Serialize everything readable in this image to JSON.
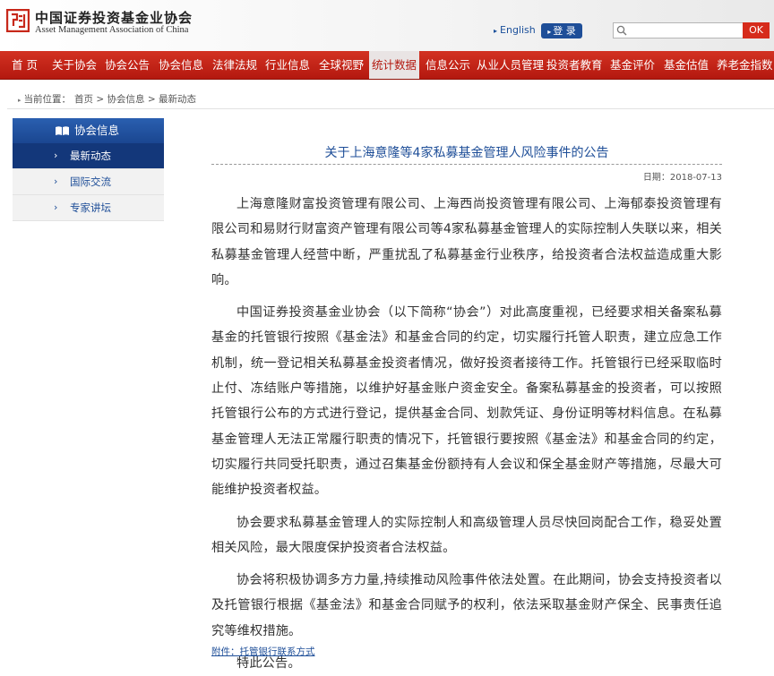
{
  "header": {
    "org_name_cn": "中国证券投资基金业协会",
    "org_name_en": "Asset Management Association of China",
    "lang_link": "English",
    "login_label": "登 录",
    "search_placeholder": "",
    "search_button": "OK"
  },
  "nav": {
    "items": [
      "首 页",
      "关于协会",
      "协会公告",
      "协会信息",
      "法律法规",
      "行业信息",
      "全球视野",
      "统计数据",
      "信息公示",
      "从业人员管理",
      "投资者教育",
      "基金评价",
      "基金估值",
      "养老金指数"
    ],
    "active_index": 7
  },
  "breadcrumb": {
    "prefix": "当前位置：",
    "path": "首页 > 协会信息 > 最新动态"
  },
  "sidebar": {
    "title": "协会信息",
    "items": [
      {
        "label": "最新动态",
        "active": true
      },
      {
        "label": "国际交流",
        "active": false
      },
      {
        "label": "专家讲坛",
        "active": false
      }
    ]
  },
  "article": {
    "title": "关于上海意隆等4家私募基金管理人风险事件的公告",
    "date": "日期：2018-07-13",
    "paragraphs": [
      "上海意隆财富投资管理有限公司、上海西尚投资管理有限公司、上海郁泰投资管理有限公司和易财行财富资产管理有限公司等4家私募基金管理人的实际控制人失联以来，相关私募基金管理人经营中断，严重扰乱了私募基金行业秩序，给投资者合法权益造成重大影响。",
      "中国证券投资基金业协会（以下简称“协会”）对此高度重视，已经要求相关备案私募基金的托管银行按照《基金法》和基金合同的约定，切实履行托管人职责，建立应急工作机制，统一登记相关私募基金投资者情况，做好投资者接待工作。托管银行已经采取临时止付、冻结账户等措施，以维护好基金账户资金安全。备案私募基金的投资者，可以按照托管银行公布的方式进行登记，提供基金合同、划款凭证、身份证明等材料信息。在私募基金管理人无法正常履行职责的情况下，托管银行要按照《基金法》和基金合同的约定，切实履行共同受托职责，通过召集基金份额持有人会议和保全基金财产等措施，尽最大可能维护投资者权益。",
      "协会要求私募基金管理人的实际控制人和高级管理人员尽快回岗配合工作，稳妥处置相关风险，最大限度保护投资者合法权益。",
      "协会将积极协调多方力量,持续推动风险事件依法处置。在此期间，协会支持投资者以及托管银行根据《基金法》和基金合同赋予的权利，依法采取基金财产保全、民事责任追究等维权措施。",
      "特此公告。"
    ],
    "attachment": "附件：托管银行联系方式"
  },
  "colors": {
    "nav_red": "#c7281a",
    "brand_blue": "#1e4e98",
    "sidebar_active": "#13377a",
    "ok_red": "#d62b1b"
  },
  "icons": [
    "logo-icon",
    "search-icon",
    "book-icon",
    "chevron-right-icon",
    "arrow-right-icon"
  ]
}
